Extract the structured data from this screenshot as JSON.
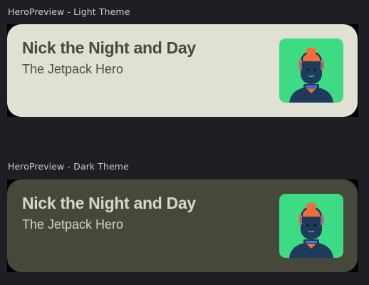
{
  "previews": [
    {
      "label": "HeroPreview - Light Theme",
      "theme": "light",
      "card_bg": "#e0e1d3",
      "hero": {
        "name": "Nick the Night and Day",
        "title": "The Jetpack Hero",
        "avatar_icon": "robot-hero-avatar"
      }
    },
    {
      "label": "HeroPreview - Dark Theme",
      "theme": "dark",
      "card_bg": "#45483b",
      "hero": {
        "name": "Nick the Night and Day",
        "title": "The Jetpack Hero",
        "avatar_icon": "robot-hero-avatar"
      }
    }
  ],
  "colors": {
    "ide_background": "#1e1f22",
    "avatar_background": "#3ddc84",
    "avatar_body": "#1f3a5a",
    "avatar_accent": "#f26b3a",
    "avatar_blue": "#3b7ddd"
  }
}
